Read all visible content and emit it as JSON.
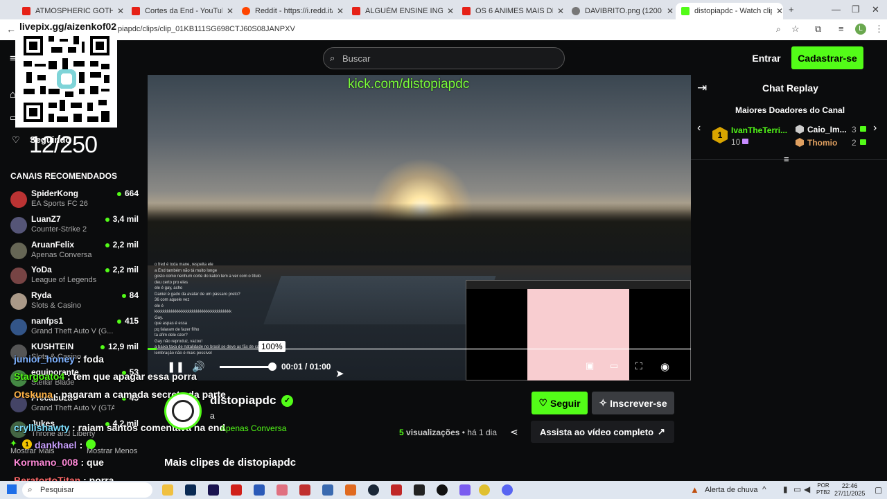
{
  "browser": {
    "tabs": [
      {
        "title": "ATMOSPHERIC GOTHIC HO",
        "color": "#e62117"
      },
      {
        "title": "Cortes da End - YouTube",
        "color": "#e62117"
      },
      {
        "title": "Reddit - https://i.redd.it/wsnbn",
        "color": "#ff4500"
      },
      {
        "title": "ALGUÉM ENSINE INGLÊS BÁSIC",
        "color": "#e62117"
      },
      {
        "title": "OS 6 ANIMES MAIS DIFERENTE",
        "color": "#e62117"
      },
      {
        "title": "DAVIBRITO.png (1200×2557)",
        "color": "#777777"
      },
      {
        "title": "distopiapdc - Watch clips o",
        "color": "#53fc18"
      }
    ],
    "url": "piapdc/clips/clip_01KB111SG698CTJ60S08JANPXV",
    "profile_initial": "L"
  },
  "overlay": {
    "qr_link": "livepix.gg/aizenkof02",
    "goal": "12/250",
    "follow_label": "Seguindo"
  },
  "header": {
    "search_placeholder": "Buscar",
    "login": "Entrar",
    "signup": "Cadastrar-se"
  },
  "sidebar": {
    "title": "CANAIS RECOMENDADOS",
    "channels": [
      {
        "name": "SpiderKong",
        "game": "EA Sports FC 26",
        "viewers": "664",
        "color": "#b33"
      },
      {
        "name": "LuanZ7",
        "game": "Counter-Strike 2",
        "viewers": "3,4 mil",
        "color": "#557"
      },
      {
        "name": "AruanFelix",
        "game": "Apenas Conversa",
        "viewers": "2,2 mil",
        "color": "#665"
      },
      {
        "name": "YoDa",
        "game": "League of Legends",
        "viewers": "2,2 mil",
        "color": "#744"
      },
      {
        "name": "Ryda",
        "game": "Slots & Casino",
        "viewers": "84",
        "color": "#a98"
      },
      {
        "name": "nanfps1",
        "game": "Grand Theft Auto V (G...",
        "viewers": "415",
        "color": "#358"
      },
      {
        "name": "KUSHTEIN",
        "game": "Slots & Casino",
        "viewers": "12,9 mil",
        "color": "#555"
      },
      {
        "name": "equinorante",
        "game": "Stellar Blade",
        "viewers": "53",
        "color": "#484"
      },
      {
        "name": "Frecabuza",
        "game": "Grand Theft Auto V (GTA)",
        "viewers": "45",
        "color": "#446"
      },
      {
        "name": "Jukes",
        "game": "Throne and Liberty",
        "viewers": "4,2 mil",
        "color": "#464"
      }
    ],
    "show_more": "Mostrar Mais",
    "show_less": "Mostrar Menos"
  },
  "overlay_chat": [
    {
      "user": "junior_honey",
      "msg": ": foda",
      "color": "#7fb2ff"
    },
    {
      "user": "Stargoato4",
      "msg": ": tem que apagar essa porra",
      "color": "#53fc18"
    },
    {
      "user": "Otskuna",
      "msg": ": pagaram a camada secreta da parte",
      "color": "#ffb347"
    },
    {
      "user": "cryllishawty",
      "msg": ": raiam santos comentava na end",
      "color": "#7fe0ff"
    },
    {
      "user": "dankhael",
      "msg": ":",
      "color": "#c9a0ff"
    },
    {
      "user": "Kormano_008",
      "msg": ": que",
      "color": "#ff8ad8"
    },
    {
      "user": "BeratortoTitan",
      "msg": ": porra",
      "color": "#ff6a6a"
    }
  ],
  "video": {
    "watermark": "kick.com/distopiapdc",
    "volume_pct": "100%",
    "time_current": "00:01",
    "time_sep": "/",
    "time_total": "01:00",
    "progress": 0.017,
    "chat_lines": [
      "o fred é toda mane, respeita ele",
      "a End também não tá muito longe",
      "gosto como nenhum corte do katon tem a ver com o título",
      "deu certo pro eles",
      "ele é gay, acho",
      "Daniel é gado da avatar de um pássaro preto?",
      "36 com aquele vez",
      "ele é",
      "kkkkkkkkkkkkkkkkkkkkkkkkkkkkkkkkkkkkk",
      "Gay.",
      "que aspas é essa",
      "pq falaram de fazer filho",
      "ta afim dele ozer?",
      "Gay não reproduz, vazou!",
      "a baixa taxa de natalidade no brasil se deve as fãs de catinas",
      "lembração não é mais possível"
    ]
  },
  "chat_replay": {
    "title": "Chat Replay",
    "donors_title": "Maiores Doadores do Canal",
    "donors": [
      {
        "rank": "1",
        "name": "IvanTheTerri...",
        "amount": "10",
        "color": "#53fc18"
      },
      {
        "rank": "2",
        "name": "Caio_Im...",
        "amount": "3",
        "color": "#ffffff"
      },
      {
        "rank": "3",
        "name": "Thomio",
        "amount": "2",
        "color": "#e0a060"
      }
    ]
  },
  "clip": {
    "channel": "distopiapdc",
    "title": "a",
    "category": "Apenas Conversa",
    "follow": "Seguir",
    "subscribe": "Inscrever-se",
    "views_count": "5",
    "views_label": "visualizações",
    "age": "há 1 dia",
    "full_video": "Assista ao vídeo completo",
    "more_clips": "Mais clipes de distopiapdc"
  },
  "taskbar": {
    "search": "Pesquisar",
    "weather": "Alerta de chuva",
    "lang1": "POR",
    "lang2": "PTB2",
    "time": "22:46",
    "date": "27/11/2025"
  }
}
